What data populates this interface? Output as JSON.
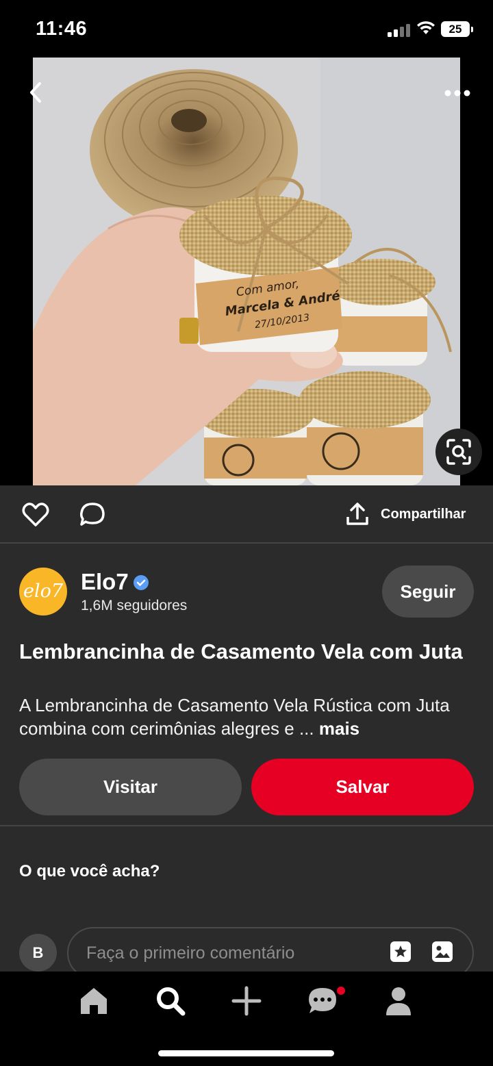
{
  "status_bar": {
    "time": "11:46",
    "battery": "25"
  },
  "pin": {
    "jar_text": {
      "line1": "Com amor,",
      "line2": "Marcela & André",
      "line3": "27/10/2013"
    }
  },
  "actions": {
    "share_label": "Compartilhar"
  },
  "creator": {
    "logo_text": "elo7",
    "name": "Elo7",
    "followers": "1,6M seguidores",
    "follow_label": "Seguir",
    "logo_color": "#f9b728"
  },
  "content": {
    "title": "Lembrancinha de Casamento Vela com Juta",
    "description": "A Lembrancinha de Casamento Vela Rústica com Juta combina com cerimônias alegres e ...",
    "more_label": "mais"
  },
  "buttons": {
    "visit": "Visitar",
    "save": "Salvar",
    "save_color": "#e60023"
  },
  "comments": {
    "prompt": "O que você acha?",
    "user_initial": "B",
    "placeholder": "Faça o primeiro comentário"
  },
  "nav": {
    "items": [
      "home-icon",
      "search-icon",
      "plus-icon",
      "messages-icon",
      "profile-icon"
    ]
  }
}
